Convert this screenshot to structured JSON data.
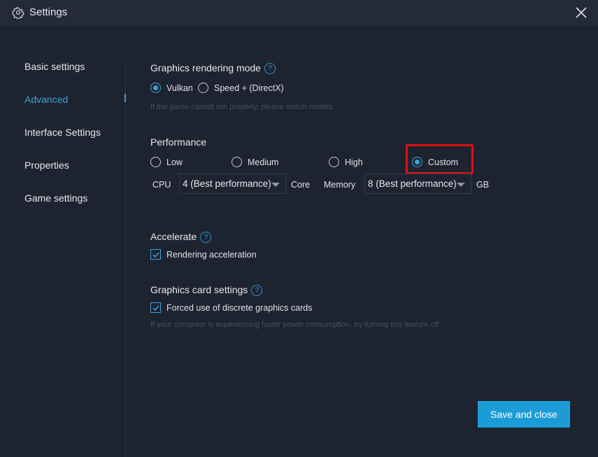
{
  "window": {
    "title": "Settings",
    "icon": "gear-icon",
    "close_icon": "close-icon"
  },
  "sidebar": {
    "items": [
      {
        "label": "Basic settings"
      },
      {
        "label": "Advanced",
        "active": true
      },
      {
        "label": "Interface Settings"
      },
      {
        "label": "Properties"
      },
      {
        "label": "Game settings"
      }
    ]
  },
  "graphics_mode": {
    "title": "Graphics rendering mode",
    "options": [
      {
        "label": "Vulkan",
        "checked": true
      },
      {
        "label": "Speed + (DirectX)",
        "checked": false
      }
    ],
    "hint": "If the game cannot run properly, please switch modes."
  },
  "performance": {
    "title": "Performance",
    "options": [
      {
        "label": "Low",
        "checked": false
      },
      {
        "label": "Medium",
        "checked": false
      },
      {
        "label": "High",
        "checked": false
      },
      {
        "label": "Custom",
        "checked": true
      }
    ],
    "cpu_label": "CPU",
    "cpu_value": "4 (Best performance)",
    "core_label": "Core",
    "memory_label": "Memory",
    "memory_value": "8 (Best performance)",
    "gb_label": "GB"
  },
  "accelerate": {
    "title": "Accelerate",
    "checkbox_label": "Rendering acceleration",
    "checked": true
  },
  "graphics_card": {
    "title": "Graphics card settings",
    "checkbox_label": "Forced use of discrete graphics cards",
    "checked": true,
    "hint": "If your computer is experiencing faster power consumption, try turning this feature off."
  },
  "footer": {
    "save_label": "Save and close"
  },
  "colors": {
    "accent": "#1c9cd7",
    "background": "#1e2330",
    "titlebar": "#252a39",
    "highlight": "#e01010"
  }
}
